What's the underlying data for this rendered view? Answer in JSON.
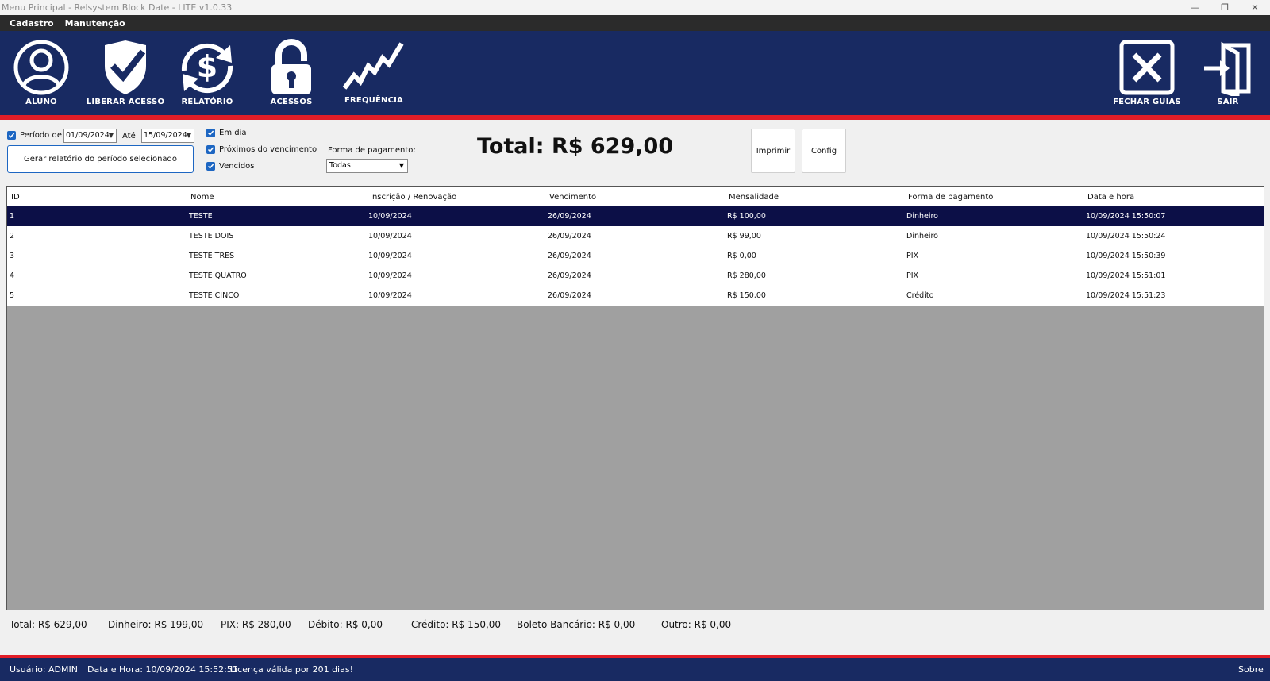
{
  "window": {
    "title": "Menu Principal - Relsystem Block Date - LITE v1.0.33",
    "controls": {
      "minimize": "—",
      "restore": "❐",
      "close": "✕"
    }
  },
  "menu": {
    "items": [
      "Cadastro",
      "Manutenção"
    ]
  },
  "toolbar": {
    "aluno": "ALUNO",
    "liberar": "LIBERAR ACESSO",
    "relatorio": "RELATÓRIO",
    "acessos": "ACESSOS",
    "frequencia": "FREQUÊNCIA",
    "fechar_guias": "FECHAR GUIAS",
    "sair": "SAIR"
  },
  "filters": {
    "periodo_label": "Período de",
    "date_from": "01/09/2024",
    "ate_label": "Até",
    "date_to": "15/09/2024",
    "generate_button": "Gerar relatório do período selecionado",
    "em_dia": "Em dia",
    "proximos": "Próximos do vencimento",
    "vencidos": "Vencidos",
    "forma_label": "Forma de pagamento:",
    "forma_value": "Todas",
    "total": "Total: R$ 629,00",
    "print_button": "Imprimir",
    "config_button": "Config"
  },
  "table": {
    "columns": [
      "ID",
      "Nome",
      "Inscrição / Renovação",
      "Vencimento",
      "Mensalidade",
      "Forma de pagamento",
      "Data e hora"
    ],
    "rows": [
      [
        "1",
        "TESTE",
        "10/09/2024",
        "26/09/2024",
        "R$ 100,00",
        "Dinheiro",
        "10/09/2024 15:50:07"
      ],
      [
        "2",
        "TESTE DOIS",
        "10/09/2024",
        "26/09/2024",
        "R$ 99,00",
        "Dinheiro",
        "10/09/2024 15:50:24"
      ],
      [
        "3",
        "TESTE TRES",
        "10/09/2024",
        "26/09/2024",
        "R$ 0,00",
        "PIX",
        "10/09/2024 15:50:39"
      ],
      [
        "4",
        "TESTE QUATRO",
        "10/09/2024",
        "26/09/2024",
        "R$ 280,00",
        "PIX",
        "10/09/2024 15:51:01"
      ],
      [
        "5",
        "TESTE CINCO",
        "10/09/2024",
        "26/09/2024",
        "R$ 150,00",
        "Crédito",
        "10/09/2024 15:51:23"
      ]
    ]
  },
  "summary": {
    "total": "Total: R$ 629,00",
    "dinheiro": "Dinheiro: R$ 199,00",
    "pix": "PIX: R$ 280,00",
    "debito": "Débito: R$ 0,00",
    "credito": "Crédito: R$ 150,00",
    "boleto": "Boleto Bancário: R$ 0,00",
    "outro": "Outro: R$ 0,00"
  },
  "status": {
    "usuario": "Usuário: ADMIN",
    "datahora": "Data e Hora: 10/09/2024 15:52:51",
    "licenca": "Licença válida por 201 dias!",
    "sobre": "Sobre"
  },
  "colors": {
    "navy": "#182a62",
    "red": "#e11d27",
    "selected_row": "#0c0f47",
    "accent_blue": "#1d66c2"
  }
}
